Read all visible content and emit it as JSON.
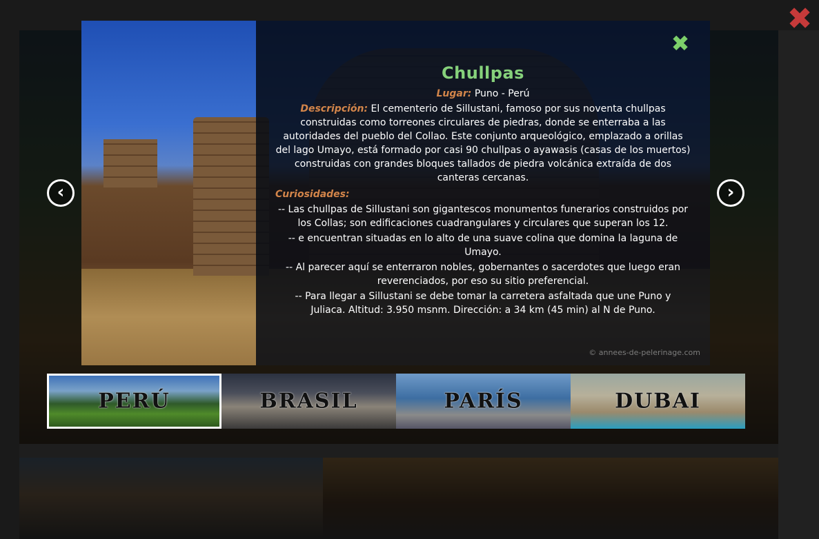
{
  "overlay": {
    "close_label": "✖"
  },
  "modal": {
    "close_label": "✖",
    "title": "Chullpas",
    "lugar_label": "Lugar:",
    "lugar_value": " Puno - Perú",
    "descripcion_label": "Descripción:",
    "descripcion_text": " El cementerio de Sillustani, famoso por sus noventa chullpas construidas como torreones circulares de piedras, donde se enterraba a las autoridades del pueblo del Collao. Este conjunto arqueológico, emplazado a orillas del lago Umayo, está formado por casi 90 chullpas o ayawasis (casas de los muertos) construidas con grandes bloques tallados de piedra volcánica extraída de dos canteras cercanas.",
    "curiosidades_label": "Curiosidades:",
    "curiosidades": [
      "-- Las chullpas de Sillustani son gigantescos monumentos funerarios construidos por los Collas; son edificaciones cuadrangulares y circulares que superan los 12.",
      "-- e encuentran situadas en lo alto de una suave colina que domina la laguna de Umayo.",
      "-- Al parecer aquí se enterraron nobles, gobernantes o sacerdotes que luego eran reverenciados, por eso su sitio preferencial.",
      "-- Para llegar a Sillustani se debe tomar la carretera asfaltada que une Puno y Juliaca. Altitud: 3.950 msnm. Dirección: a 34 km (45 min) al N de Puno."
    ],
    "credit": "© annees-de-pelerinage.com"
  },
  "nav": {
    "prev_label": "‹",
    "next_label": "›"
  },
  "thumbnails": [
    {
      "label": "PERÚ",
      "selected": true
    },
    {
      "label": "BRASIL",
      "selected": false
    },
    {
      "label": "PARÍS",
      "selected": false
    },
    {
      "label": "DUBAI",
      "selected": false
    }
  ],
  "colors": {
    "title": "#86d17b",
    "label_accent": "#d3854a",
    "overlay_close": "#c63a3a",
    "modal_close": "#7ccf6a"
  }
}
